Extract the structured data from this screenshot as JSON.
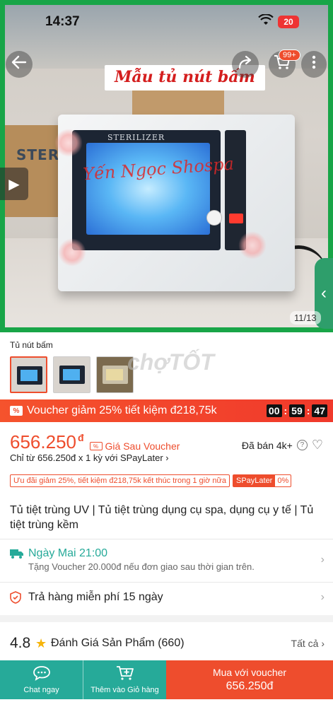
{
  "status_bar": {
    "time": "14:37",
    "battery": "20"
  },
  "hero": {
    "banner_text": "Mẫu tủ nút bấm",
    "watermark": "Yến Ngọc Shospa",
    "machine_label": "STERILIZER",
    "box_text": "STERII",
    "cart_badge": "99+",
    "counter": "11/13",
    "icons": {
      "back": "back-arrow-icon",
      "share": "share-icon",
      "cart": "cart-icon",
      "more": "more-icon",
      "play": "play-icon",
      "side": "chevron-left-icon"
    }
  },
  "variation": {
    "label": "Tủ nút bấm",
    "watermark": "chợTỐT"
  },
  "voucher_bar": {
    "text": "Voucher giảm 25% tiết kiệm đ218,75k",
    "icon_text": "%",
    "timer": [
      "00",
      "59",
      "47"
    ]
  },
  "price": {
    "amount": "656.250",
    "currency": "đ",
    "after_voucher": "Giá Sau Voucher",
    "sold": "Đã bán 4k+",
    "installment": "Chỉ từ 656.250đ x 1 kỳ với SPayLater ›",
    "promo": "Ưu đãi giảm 25%, tiết kiệm đ218,75k kết thúc trong 1 giờ nữa",
    "spaylater": "SPayLater",
    "spaylater_rate": "0%"
  },
  "product_title": "Tủ tiệt trùng UV | Tủ tiệt trùng dụng cụ spa, dụng cụ y tế | Tủ tiệt trùng kềm",
  "shipping": {
    "main": "Ngày Mai 21:00",
    "sub": "Tặng Voucher 20.000đ nếu đơn giao sau thời gian trên."
  },
  "returns": {
    "text": "Trả hàng miễn phí 15 ngày"
  },
  "rating": {
    "score": "4.8",
    "title": "Đánh Giá Sản Phẩm (660)",
    "see_all": "Tất cả"
  },
  "bottom_bar": {
    "chat_label": "Chat ngay",
    "cart_label": "Thêm vào Giỏ hàng",
    "buy_line1": "Mua với voucher",
    "buy_line2": "656.250đ"
  },
  "colors": {
    "accent": "#ee4d2d",
    "teal": "#26aa99",
    "frame_green": "#18a548"
  }
}
